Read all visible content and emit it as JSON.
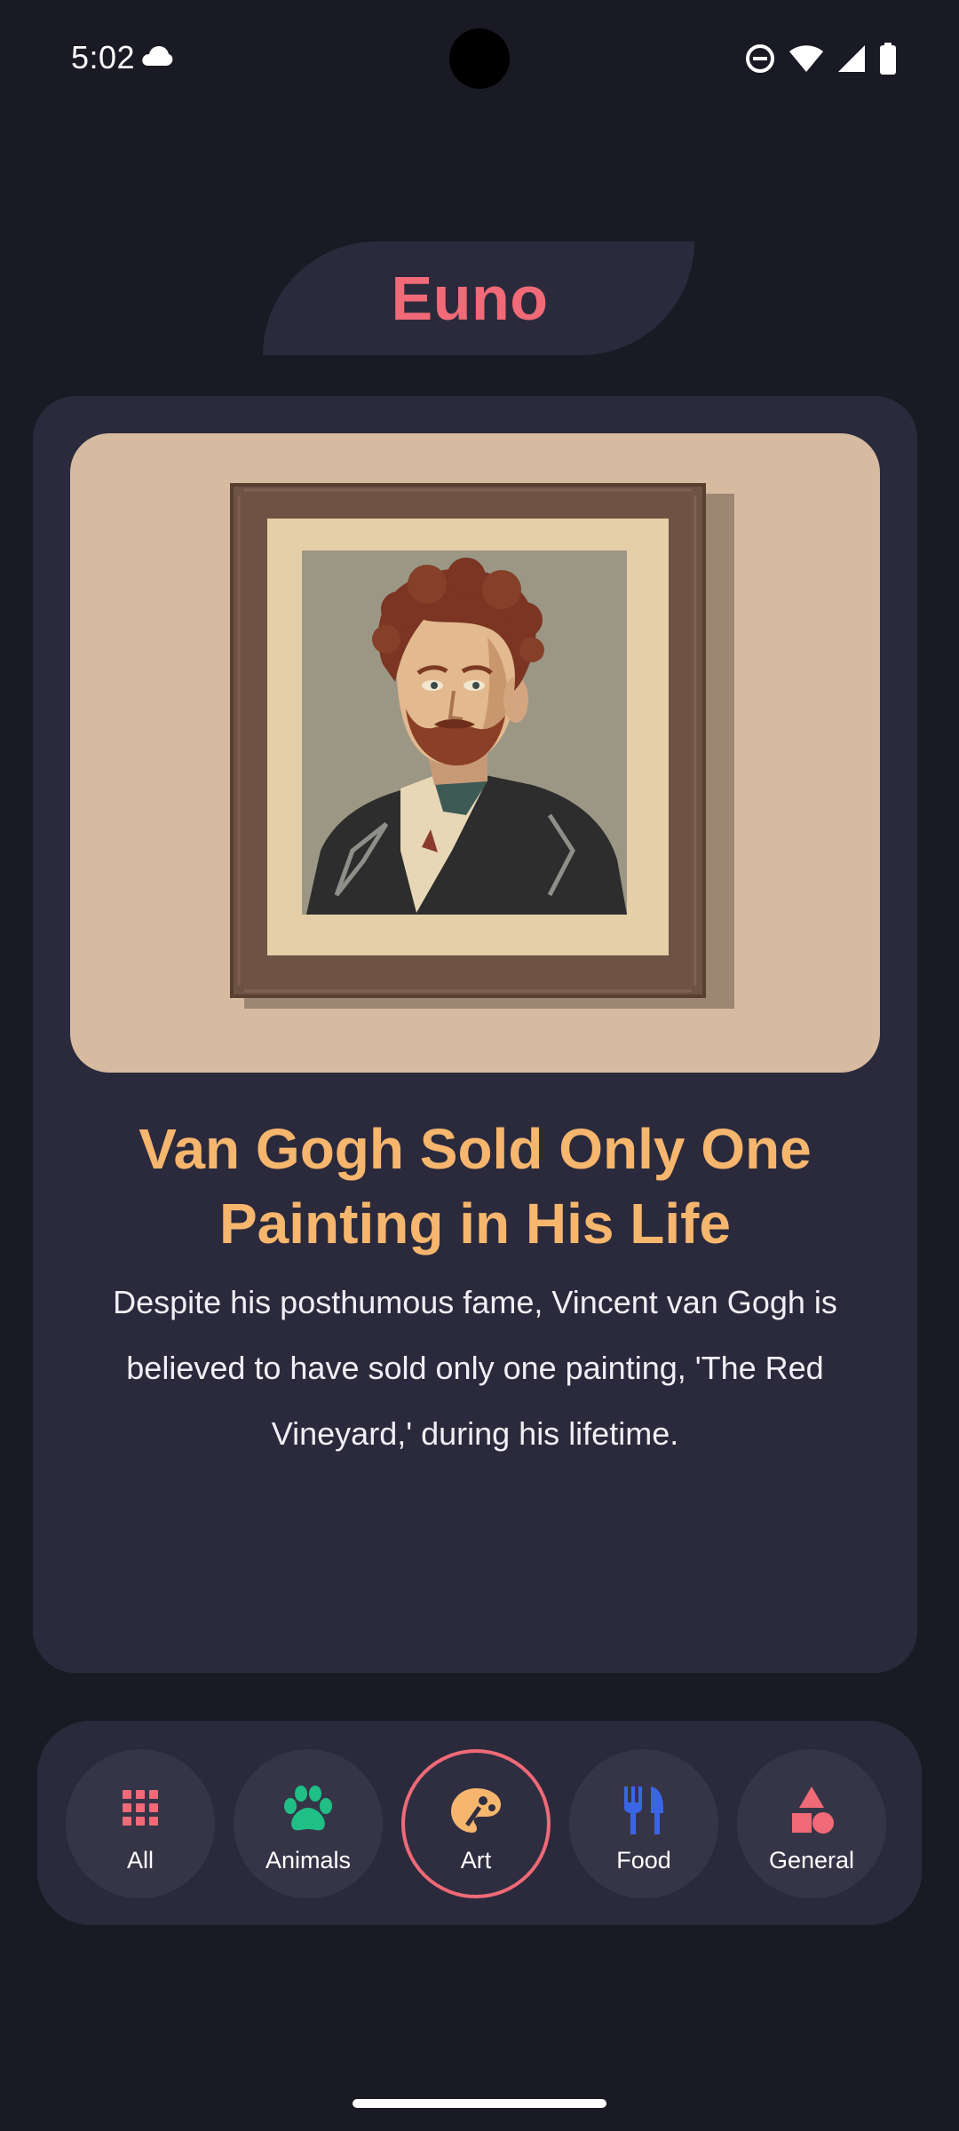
{
  "status_bar": {
    "time": "5:02",
    "icons": [
      "cloud-icon",
      "do-not-disturb-icon",
      "wifi-icon",
      "cell-signal-icon",
      "battery-icon"
    ]
  },
  "header": {
    "title": "Euno"
  },
  "fact": {
    "title": "Van Gogh Sold Only One Painting in His Life",
    "body": "Despite his posthumous fame, Vincent van Gogh is believed to have sold only one painting, 'The Red Vineyard,' during his lifetime."
  },
  "categories": [
    {
      "label": "All",
      "icon": "grid-icon",
      "color": "#f06a77"
    },
    {
      "label": "Animals",
      "icon": "paw-icon",
      "color": "#1fbf86"
    },
    {
      "label": "Art",
      "icon": "palette-icon",
      "color": "#f6b66e",
      "selected": true
    },
    {
      "label": "Food",
      "icon": "utensils-icon",
      "color": "#3a66e6"
    },
    {
      "label": "General",
      "icon": "shapes-icon",
      "color": "#f06a77"
    }
  ],
  "colors": {
    "background": "#1a1a25",
    "card": "#2b2a3c",
    "accent": "#f06a77",
    "title": "#f6b66e"
  }
}
